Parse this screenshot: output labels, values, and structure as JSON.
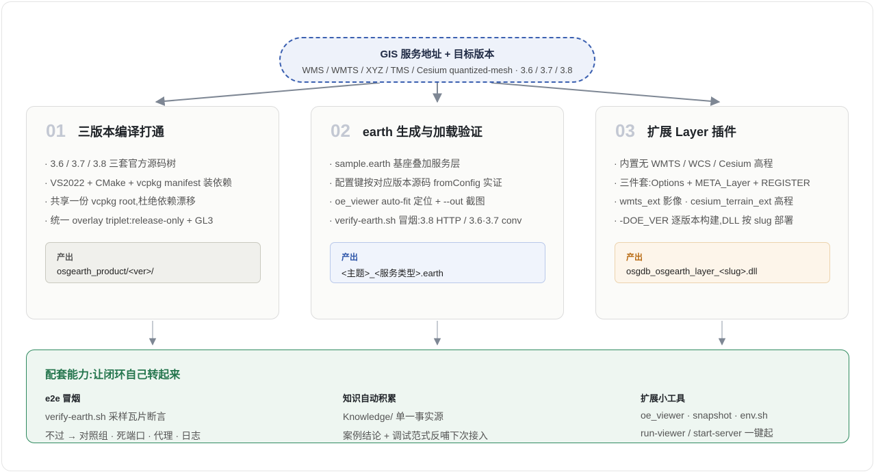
{
  "top": {
    "title": "GIS 服务地址 + 目标版本",
    "subtitle": "WMS / WMTS / XYZ / TMS / Cesium quantized-mesh · 3.6 / 3.7 / 3.8"
  },
  "cards": [
    {
      "num": "01",
      "title": "三版本编译打通",
      "items": [
        "· 3.6 / 3.7 / 3.8 三套官方源码树",
        "· VS2022 + CMake + vcpkg manifest 装依赖",
        "· 共享一份 vcpkg root,杜绝依赖漂移",
        "· 统一 overlay triplet:release-only + GL3"
      ],
      "output_label": "产出",
      "output_value": "osgearth_product/<ver>/"
    },
    {
      "num": "02",
      "title": "earth 生成与加载验证",
      "items": [
        "· sample.earth 基座叠加服务层",
        "· 配置键按对应版本源码 fromConfig 实证",
        "· oe_viewer auto-fit 定位 + --out 截图",
        "· verify-earth.sh 冒烟:3.8 HTTP / 3.6·3.7 conv"
      ],
      "output_label": "产出",
      "output_value": "<主题>_<服务类型>.earth"
    },
    {
      "num": "03",
      "title": "扩展 Layer 插件",
      "items": [
        "· 内置无 WMTS / WCS / Cesium 高程",
        "· 三件套:Options + META_Layer + REGISTER",
        "· wmts_ext 影像 · cesium_terrain_ext 高程",
        "· -DOE_VER 逐版本构建,DLL 按 slug 部署"
      ],
      "output_label": "产出",
      "output_value": "osgdb_osgearth_layer_<slug>.dll"
    }
  ],
  "bottom": {
    "title": "配套能力:让闭环自己转起来",
    "columns": [
      {
        "title": "e2e 冒烟",
        "lines": [
          "verify-earth.sh 采样瓦片断言",
          "不过 → 对照组 · 死端口 · 代理 · 日志"
        ]
      },
      {
        "title": "知识自动积累",
        "lines": [
          "Knowledge/ 单一事实源",
          "案例结论 + 调试范式反哺下次接入"
        ]
      },
      {
        "title": "扩展小工具",
        "lines": [
          "oe_viewer · snapshot · env.sh",
          "run-viewer / start-server 一键起"
        ]
      }
    ]
  },
  "colors": {
    "top_border": "#3a5fb0",
    "arrow": "#7e8794",
    "bottom_accent": "#2f8a5f",
    "output_1": "#f0f0ec",
    "output_2": "#f0f4fc",
    "output_3": "#fdf5ea"
  }
}
